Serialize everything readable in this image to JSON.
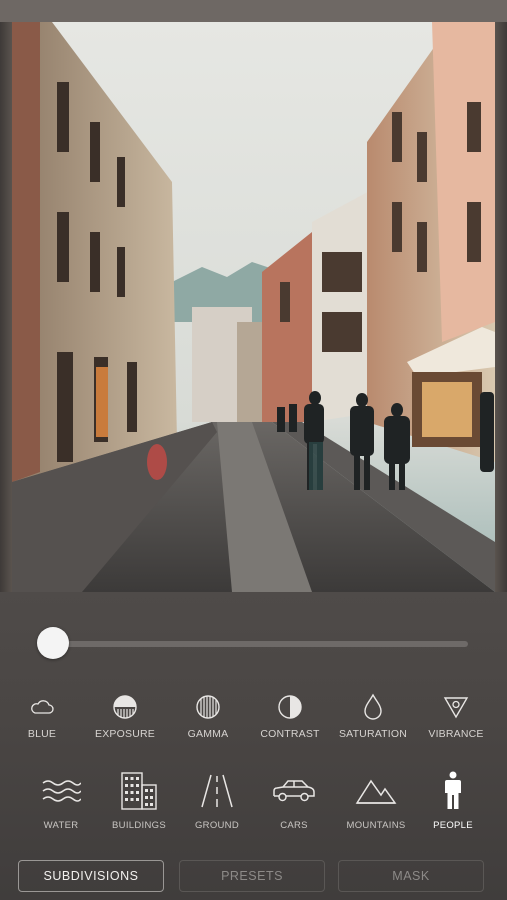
{
  "adjustments": [
    {
      "label": "BLUE",
      "icon": "cloud-icon"
    },
    {
      "label": "EXPOSURE",
      "icon": "exposure-icon"
    },
    {
      "label": "GAMMA",
      "icon": "gamma-icon"
    },
    {
      "label": "CONTRAST",
      "icon": "contrast-icon"
    },
    {
      "label": "SATURATION",
      "icon": "saturation-drop-icon"
    },
    {
      "label": "VIBRANCE",
      "icon": "vibrance-triangle-icon"
    }
  ],
  "masks": [
    {
      "label": "WATER",
      "icon": "water-waves-icon"
    },
    {
      "label": "BUILDINGS",
      "icon": "buildings-icon"
    },
    {
      "label": "GROUND",
      "icon": "road-icon"
    },
    {
      "label": "CARS",
      "icon": "car-icon"
    },
    {
      "label": "MOUNTAINS",
      "icon": "mountains-icon"
    },
    {
      "label": "PEOPLE",
      "icon": "person-icon",
      "active": true
    }
  ],
  "slider": {
    "value": 0.0
  },
  "tabs": [
    {
      "label": "SUBDIVISIONS",
      "active": true
    },
    {
      "label": "PRESETS",
      "active": false
    },
    {
      "label": "MASK",
      "active": false
    }
  ],
  "colors": {
    "accent_active": "#ffffff",
    "inactive_text": "#8d8a88"
  }
}
